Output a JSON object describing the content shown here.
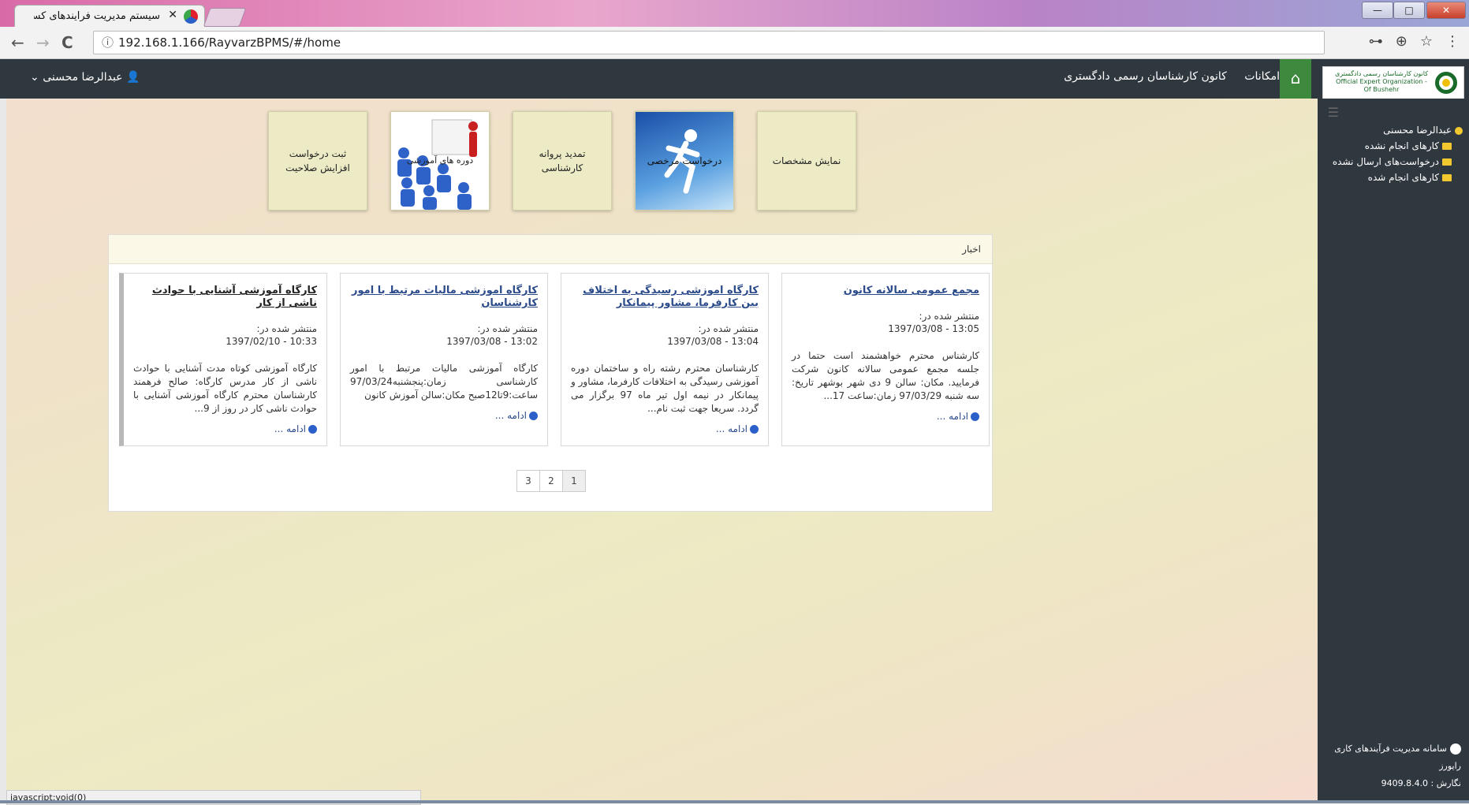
{
  "browser": {
    "tab_title": "سیستم مدیریت فرایندهای کسب و",
    "tab_close": "✕",
    "url": "192.168.1.166/RayvarzBPMS/#/home",
    "nav_back": "←",
    "nav_forward": "→",
    "nav_reload": "C",
    "info_icon": "ⓘ",
    "key_icon": "⊶",
    "zoom_icon": "⊕",
    "star_icon": "☆",
    "menu_icon": "⋮",
    "status_text": "javascript:void(0)",
    "win_min": "—",
    "win_max": "□",
    "win_close": "✕"
  },
  "navbar": {
    "user_label": "عبدالرضا محسنی",
    "user_caret": "⌄",
    "user_icon": "👤",
    "center_title": "کانون کارشناسان رسمی دادگستری",
    "features_link": "امکانات",
    "home_icon": "⌂",
    "logo_text": "کانون کارشناسان رسمی دادگستری - Official Expert Organization Of Bushehr"
  },
  "sidebar": {
    "hamburger": "☰",
    "user_name": "عبدالرضا محسنی",
    "items": [
      {
        "label": "کارهای انجام نشده"
      },
      {
        "label": "درخواست‌های ارسال نشده"
      },
      {
        "label": "کارهای انجام شده"
      }
    ],
    "footer_title": "سامانه مدیریت فرآیندهای کاری رایورز",
    "footer_version": "نگارش : 9409.8.4.0"
  },
  "tiles": [
    {
      "label": "نمایش مشخصات"
    },
    {
      "label": "درخواست مرخصی"
    },
    {
      "label": "تمدید پروانه کارشناسی"
    },
    {
      "label": "دوره های آموزشی"
    },
    {
      "label": "ثبت درخواست افزایش صلاحیت"
    }
  ],
  "news": {
    "header": "اخبار",
    "more_label": "ادامه ...",
    "items": [
      {
        "title": "مجمع عمومی سالانه کانون",
        "published_label": "منتشر شده در:",
        "date": "13:05 - 1397/03/08",
        "body": "کارشناس محترم خواهشمند است حتما در جلسه مجمع عمومی سالانه کانون شرکت فرمایید. مکان: سالن 9 دی شهر بوشهر تاریخ: سه شنبه 97/03/29 زمان:ساعت 17..."
      },
      {
        "title": "کارگاه اموزشی رسیدگی به اختلاف بین کارفرما، مشاور پیمانکار",
        "published_label": "منتشر شده در:",
        "date": "13:04 - 1397/03/08",
        "body": "کارشناسان محترم رشته راه و ساختمان دوره آموزشی رسیدگی به اختلافات کارفرما، مشاور و پیمانکار در نیمه اول تیر ماه 97 برگزار می گردد. سریعا جهت ثبت نام..."
      },
      {
        "title": "کارگاه اموزشی مالیات مرتبط با امور کارشناسان",
        "published_label": "منتشر شده در:",
        "date": "13:02 - 1397/03/08",
        "body": "کارگاه آموزشی مالیات مرتبط با امور کارشناسی زمان:پنجشنبه97/03/24 ساعت:9تا12صبح مکان:سالن آموزش کانون"
      },
      {
        "title": "کارگاه آموزشی آشنایی با حوادث ناشی از کار",
        "published_label": "منتشر شده در:",
        "date": "10:33 - 1397/02/10",
        "body": "کارگاه آموزشی کوتاه مدت آشنایی با حوادث ناشی از کار مدرس کارگاه: صالح فرهمند کارشناسان محترم کارگاه آموزشی آشنایی با حوادث ناشی کار در روز از 9..."
      }
    ],
    "pages": [
      "1",
      "2",
      "3"
    ]
  }
}
